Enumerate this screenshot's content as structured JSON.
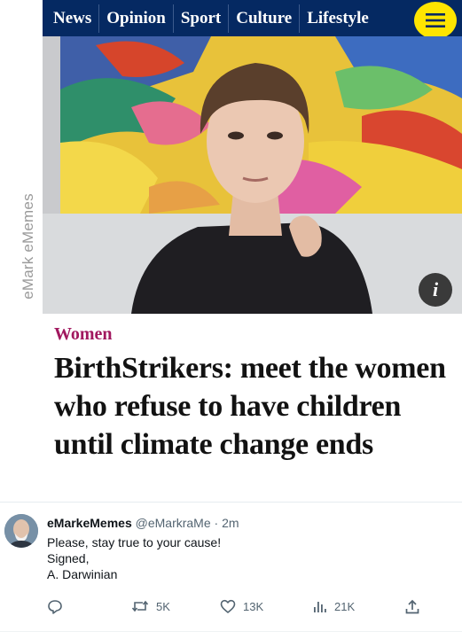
{
  "watermark": "eMark eMemes",
  "nav": {
    "items": [
      "News",
      "Opinion",
      "Sport",
      "Culture",
      "Lifestyle"
    ],
    "menu_icon": "hamburger-menu-icon"
  },
  "article": {
    "section": "Women",
    "headline": "BirthStrikers: meet the women who refuse to have children until climate change ends",
    "info_label": "i"
  },
  "tweet": {
    "author": "eMarkeMemes",
    "handle": "@eMarkraMe",
    "time": "· 2m",
    "lines": [
      "Please, stay true to your cause!",
      "Signed,",
      "A. Darwinian"
    ],
    "retweets": "5K",
    "likes": "13K",
    "views": "21K"
  },
  "colors": {
    "nav_bg": "#052962",
    "menu_button": "#ffe500",
    "section": "#a1185f",
    "meta_text": "#536471"
  }
}
